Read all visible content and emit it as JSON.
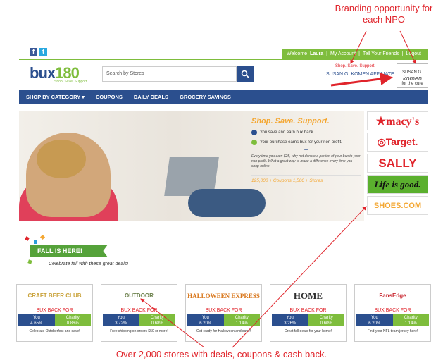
{
  "annotations": {
    "branding": "Branding opportunity for each NPO",
    "stores": "Over 2,000 stores with deals, coupons & cash back."
  },
  "header": {
    "social": [
      "f",
      "t"
    ],
    "welcome_prefix": "Welcome",
    "user": "Laura",
    "links": [
      "My Account",
      "Tell Your Friends",
      "Logout"
    ],
    "logo_main": "bux",
    "logo_num": "180",
    "logo_tag": "Shop. Save. Support.",
    "search_placeholder": "Search by Stores",
    "tagline": "Shop. Save. Support.",
    "affiliate": "SUSAN G. KOMEN AFFILIATE",
    "komen_top": "SUSAN G.",
    "komen_mid": "komen",
    "komen_bottom": "for the cure"
  },
  "nav": [
    "SHOP BY CATEGORY ▾",
    "COUPONS",
    "DAILY DEALS",
    "GROCERY SAVINGS"
  ],
  "hero": {
    "title": "Shop. Save. Support.",
    "line1": "You save and earn bux back.",
    "line2": "Your purchase earns bux for your non profit.",
    "plus": "+",
    "text": "Every time you earn $25, why not donate a portion of your bux to your non profit. What a great way to make a difference every time you shop online!",
    "stats": "125,000 + Coupons  1,500 + Stores"
  },
  "stores": [
    "★macy's",
    "◎Target.",
    "SALLY",
    "Life is good.",
    "SHOES.COM"
  ],
  "fall": {
    "badge": "FALL IS HERE!",
    "sub": "Celebrate fall with these great deals!"
  },
  "deals": [
    {
      "logo": "CRAFT BEER CLUB",
      "bb": "BUX BACK FOR",
      "you_label": "You",
      "you": "4.65%",
      "charity_label": "Charity",
      "charity": "0.86%",
      "text": "Celebrate Oktoberfest and save!",
      "color": "#c9a23a"
    },
    {
      "logo": "OUTDOOR",
      "bb": "BUX BACK FOR",
      "you_label": "You",
      "you": "3.72%",
      "charity_label": "Charity",
      "charity": "0.68%",
      "text": "Free shipping on orders $50 or more!",
      "color": "#6a7f4a"
    },
    {
      "logo": "HALLOWEEN EXPRESS",
      "bb": "BUX BACK FOR",
      "you_label": "You",
      "you": "6.20%",
      "charity_label": "Charity",
      "charity": "1.14%",
      "text": "Get ready for Halloween and save!",
      "color": "#d9781e"
    },
    {
      "logo": "HOME",
      "bb": "BUX BACK FOR",
      "you_label": "You",
      "you": "3.26%",
      "charity_label": "Charity",
      "charity": "0.60%",
      "text": "Great fall deals for your home!",
      "color": "#2e2e2e"
    },
    {
      "logo": "FansEdge",
      "bb": "BUX BACK FOR",
      "you_label": "You",
      "you": "6.20%",
      "charity_label": "Charity",
      "charity": "1.14%",
      "text": "Find your NFL team jersey here!",
      "color": "#c8262f"
    }
  ]
}
